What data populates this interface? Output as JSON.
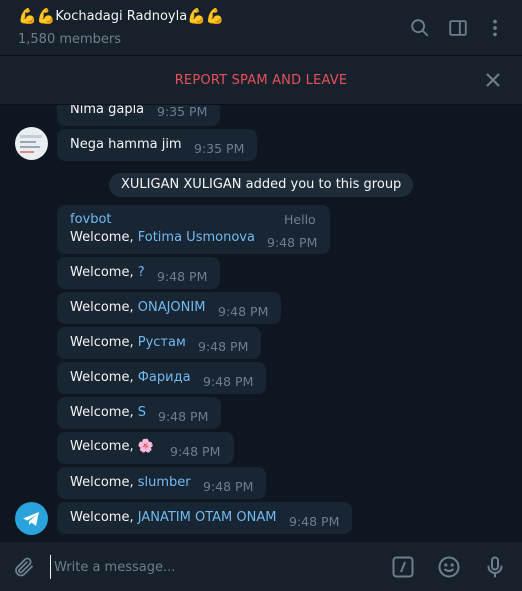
{
  "header": {
    "title": "Kochadagi Radnoyla",
    "members": "1,580 members",
    "title_emoji": "💪"
  },
  "spam_bar": {
    "label": "REPORT SPAM AND LEAVE"
  },
  "messages": [
    {
      "text": "Nima gapla",
      "time": "9:35 PM"
    },
    {
      "text": "Nega hamma jim",
      "time": "9:35 PM"
    }
  ],
  "service_message": "XULIGAN XULIGAN added you to this group",
  "bot_message": {
    "sender": "fovbot",
    "reply_text": "Hello",
    "prefix": "Welcome, ",
    "name": "Fotima Usmonova",
    "time": "9:48 PM"
  },
  "welcomes": [
    {
      "prefix": "Welcome, ",
      "name": "?",
      "time": "9:48 PM"
    },
    {
      "prefix": "Welcome, ",
      "name": "ONAJONIM",
      "time": "9:48 PM"
    },
    {
      "prefix": "Welcome, ",
      "name": "Рустам",
      "time": "9:48 PM"
    },
    {
      "prefix": "Welcome, ",
      "name": "Фарида",
      "time": "9:48 PM"
    },
    {
      "prefix": "Welcome, ",
      "name": "S",
      "time": "9:48 PM"
    },
    {
      "prefix": "Welcome, ",
      "name": "🌸",
      "time": "9:48 PM"
    },
    {
      "prefix": "Welcome, ",
      "name": "slumber",
      "time": "9:48 PM"
    },
    {
      "prefix": "Welcome, ",
      "name": "JANATIM OTAM ONAM",
      "time": "9:48 PM"
    }
  ],
  "composer": {
    "placeholder": "Write a message..."
  },
  "colors": {
    "background": "#0e1621",
    "panel": "#17212b",
    "bubble": "#182533",
    "accent": "#71baf2",
    "danger": "#e8505b",
    "muted": "#6d7f8f"
  },
  "icons": [
    "search-icon",
    "sidebar-toggle-icon",
    "more-vert-icon",
    "close-icon",
    "telegram-icon",
    "attach-icon",
    "commands-icon",
    "emoji-icon",
    "microphone-icon"
  ]
}
